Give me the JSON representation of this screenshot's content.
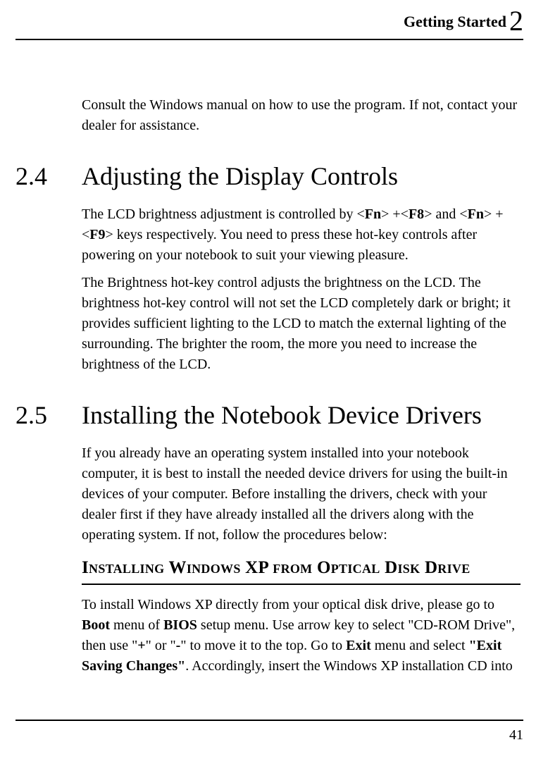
{
  "header": {
    "title": "Getting Started",
    "chapter": "2"
  },
  "intro_para": "Consult the Windows manual on how to use the program. If not, contact your dealer for assistance.",
  "sections": [
    {
      "num": "2.4",
      "title": "Adjusting the Display Controls",
      "para1_a": "The LCD brightness adjustment is controlled by <",
      "fn1": "Fn",
      "para1_b": "> +<",
      "f8": "F8",
      "para1_c": "> and <",
      "fn2": "Fn",
      "para1_d": "> + <",
      "f9": "F9",
      "para1_e": "> keys respectively. You need to press these hot-key controls after powering on your notebook to suit your viewing pleasure.",
      "para2": "The Brightness hot-key control adjusts the brightness on the LCD. The brightness hot-key control will not set the LCD completely dark or bright; it provides sufficient lighting to the LCD to match the external lighting of the surrounding. The brighter the room, the more you need to increase the brightness of the LCD."
    },
    {
      "num": "2.5",
      "title": "Installing the Notebook Device Drivers",
      "para1": "If you already have an operating system installed into your notebook computer, it is best to install the needed device drivers for using the built-in devices of your computer. Before installing the drivers, check with your dealer first if they have already installed all the drivers along with the operating system. If not, follow the procedures below:",
      "subheading": "Installing Windows XP from Optical Disk Drive",
      "p2_a": "To install Windows XP directly from your optical disk drive, please go to ",
      "boot": "Boot",
      "p2_b": " menu of ",
      "bios": "BIOS",
      "p2_c": " setup menu. Use arrow key to select \"CD-ROM Drive\", then use \"",
      "plus": "+",
      "p2_d": "\" or \"",
      "minus": "-",
      "p2_e": "\" to move it to the top. Go to ",
      "exit": "Exit",
      "p2_f": " menu and select ",
      "esc": "\"Exit Saving Changes\"",
      "p2_g": ". Accordingly, insert the Windows XP installation CD into"
    }
  ],
  "page_number": "41"
}
